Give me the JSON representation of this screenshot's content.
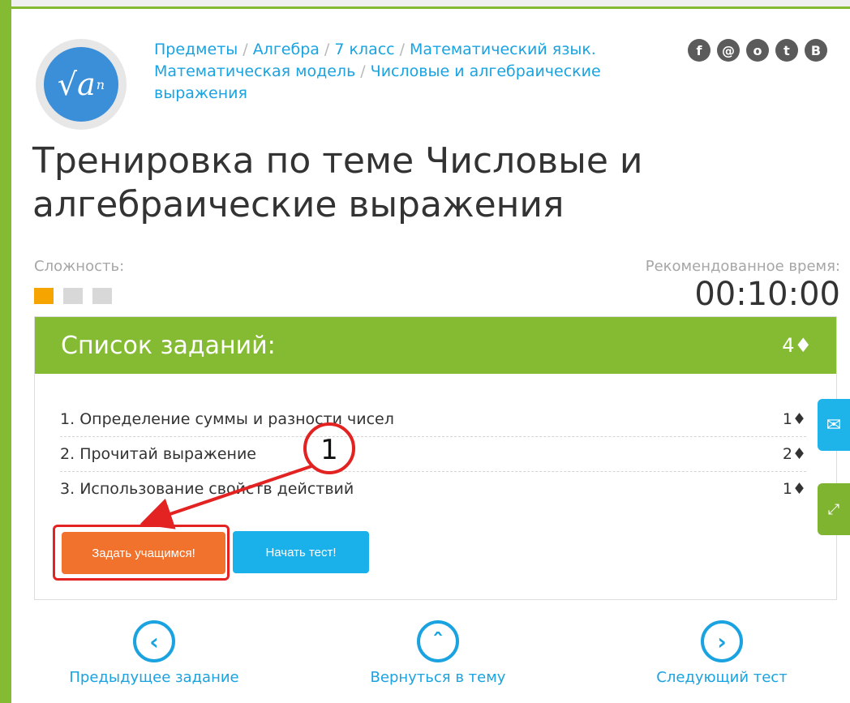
{
  "breadcrumb": [
    "Предметы",
    "Алгебра",
    "7 класс",
    "Математический язык. Математическая модель",
    "Числовые и алгебраические выражения"
  ],
  "social_icons": [
    "facebook-icon",
    "mail-icon",
    "odnoklassniki-icon",
    "twitter-icon",
    "vk-icon"
  ],
  "page_title": "Тренировка по теме Числовые и алгебраические выражения",
  "difficulty": {
    "label": "Сложность:",
    "level": 1,
    "max": 3
  },
  "recommended": {
    "label": "Рекомендованное время:",
    "time": "00:10:00"
  },
  "task_list": {
    "header": "Список заданий:",
    "total_points": "4♦",
    "items": [
      {
        "num": "1.",
        "title": "Определение суммы и разности чисел",
        "points": "1♦"
      },
      {
        "num": "2.",
        "title": "Прочитай выражение",
        "points": "2♦"
      },
      {
        "num": "3.",
        "title": "Использование свойств действий",
        "points": "1♦"
      }
    ]
  },
  "buttons": {
    "assign": "Задать учащимся!",
    "start": "Начать тест!"
  },
  "annotation": {
    "number": "1"
  },
  "nav": {
    "prev": "Предыдущее задание",
    "back": "Вернуться в тему",
    "next": "Следующий тест"
  },
  "colors": {
    "green": "#85bb32",
    "blue": "#1aa3e0",
    "orange": "#f0722d",
    "red": "#e32222",
    "amber": "#f5a400"
  }
}
